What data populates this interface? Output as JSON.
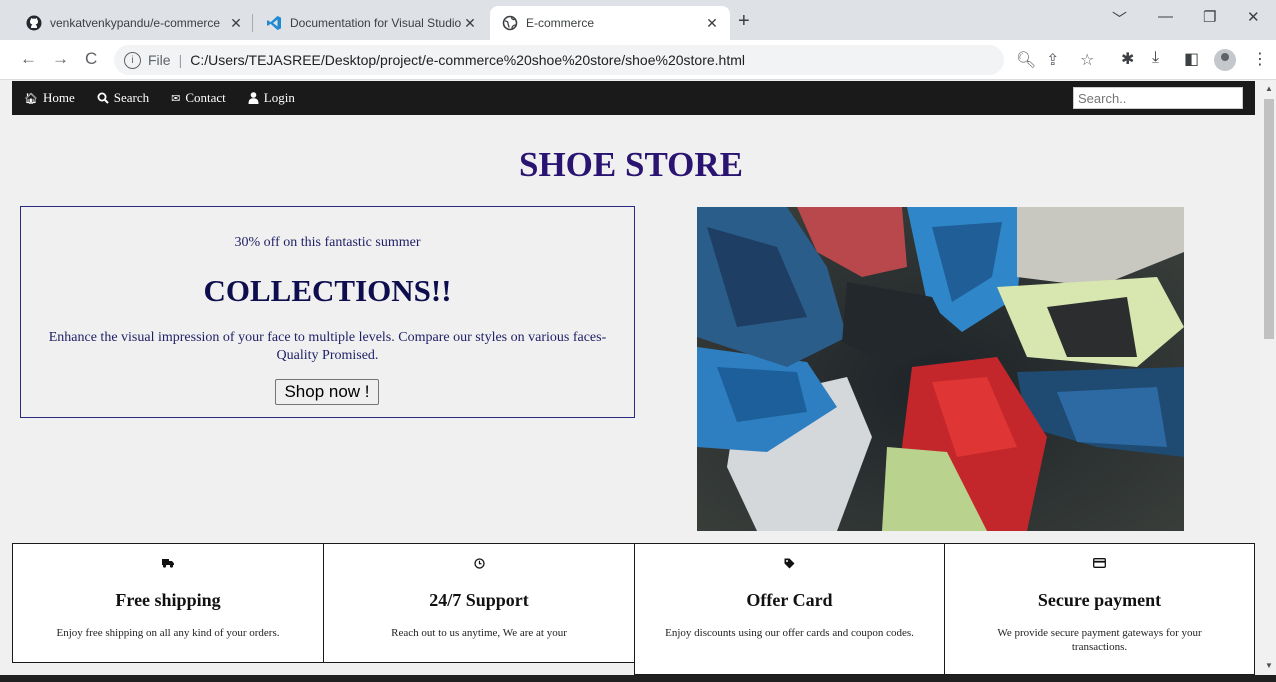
{
  "browser": {
    "tabs": [
      {
        "title": "venkatvenkypandu/e-commerce",
        "icon": "github-icon"
      },
      {
        "title": "Documentation for Visual Studio",
        "icon": "vscode-icon"
      },
      {
        "title": "E-commerce",
        "icon": "globe-icon",
        "active": true
      }
    ],
    "address": {
      "scheme": "File",
      "url": "C:/Users/TEJASREE/Desktop/project/e-commerce%20shoe%20store/shoe%20store.html"
    }
  },
  "site": {
    "nav": {
      "home": "Home",
      "search": "Search",
      "contact": "Contact",
      "login": "Login",
      "search_placeholder": "Search.."
    },
    "title": "SHOE STORE",
    "promo": {
      "lead": "30% off on this fantastic summer",
      "headline": "COLLECTIONS!!",
      "description": "Enhance the visual impression of your face to multiple levels. Compare our styles on various faces- Quality Promised.",
      "button": "Shop now !"
    },
    "hero_image": "sneakers-circle-photo",
    "features": [
      {
        "icon": "truck-icon",
        "title": "Free shipping",
        "desc": "Enjoy free shipping on all any kind of your orders."
      },
      {
        "icon": "clock-icon",
        "title": "24/7 Support",
        "desc": "Reach out to us anytime, We are at your"
      },
      {
        "icon": "tag-icon",
        "title": "Offer Card",
        "desc": "Enjoy discounts using our offer cards and coupon codes."
      },
      {
        "icon": "credit-card-icon",
        "title": "Secure payment",
        "desc": "We provide secure payment gateways for your transactions."
      }
    ]
  }
}
